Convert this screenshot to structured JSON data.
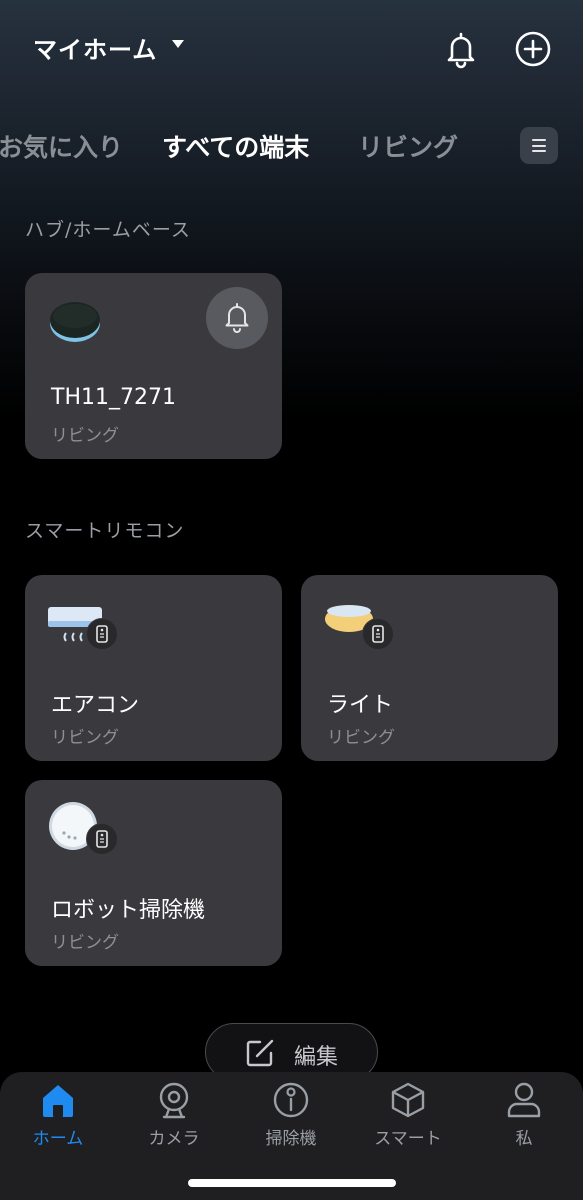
{
  "header": {
    "home_name": "マイホーム",
    "icons": {
      "notification": "bell-icon",
      "add": "plus-circle-icon",
      "dropdown": "caret-down-icon"
    }
  },
  "tabs": [
    {
      "label": "お気に入り",
      "active": false
    },
    {
      "label": "すべての端末",
      "active": true
    },
    {
      "label": "リビング",
      "active": false
    }
  ],
  "sections": {
    "hub": {
      "title": "ハブ/ホームベース",
      "devices": [
        {
          "name": "TH11_7271",
          "room": "リビング",
          "icon": "hub-device-icon"
        }
      ]
    },
    "remote": {
      "title": "スマートリモコン",
      "devices": [
        {
          "name": "エアコン",
          "room": "リビング",
          "icon": "air-conditioner-icon"
        },
        {
          "name": "ライト",
          "room": "リビング",
          "icon": "ceiling-light-icon"
        },
        {
          "name": "ロボット掃除機",
          "room": "リビング",
          "icon": "robot-vacuum-icon"
        }
      ]
    }
  },
  "edit_button": {
    "label": "編集"
  },
  "bottom_nav": [
    {
      "label": "ホーム",
      "icon": "home-icon",
      "active": true
    },
    {
      "label": "カメラ",
      "icon": "camera-icon",
      "active": false
    },
    {
      "label": "掃除機",
      "icon": "vacuum-icon",
      "active": false
    },
    {
      "label": "スマート",
      "icon": "cube-icon",
      "active": false
    },
    {
      "label": "私",
      "icon": "person-icon",
      "active": false
    }
  ],
  "colors": {
    "accent": "#1f8bf0",
    "card": "#3a3a3e",
    "nav": "#1f1f22"
  }
}
